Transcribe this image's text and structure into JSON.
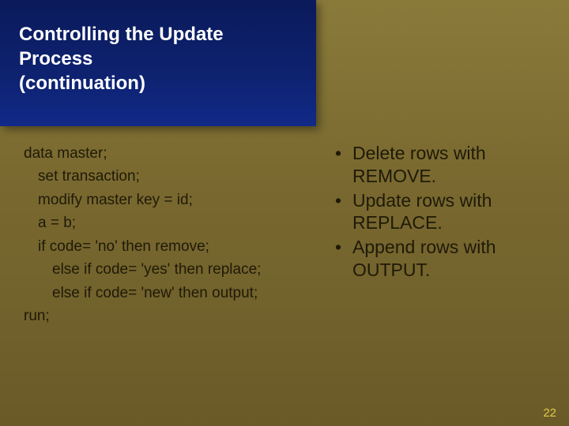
{
  "title_line1": "Controlling the Update Process",
  "title_line2": "(continuation)",
  "code": {
    "l0": "data master;",
    "l1": "set transaction;",
    "l2": "modify master key = id;",
    "l3": "a = b;",
    "l4": "if code= 'no' then remove;",
    "l5": "else if code= 'yes' then replace;",
    "l6": "else if code= 'new' then output;",
    "l7": "run;"
  },
  "bullets": {
    "b0": "Delete rows with REMOVE.",
    "b1": "Update rows with REPLACE.",
    "b2": "Append rows with OUTPUT.",
    "dot": "•"
  },
  "page_num": "22"
}
